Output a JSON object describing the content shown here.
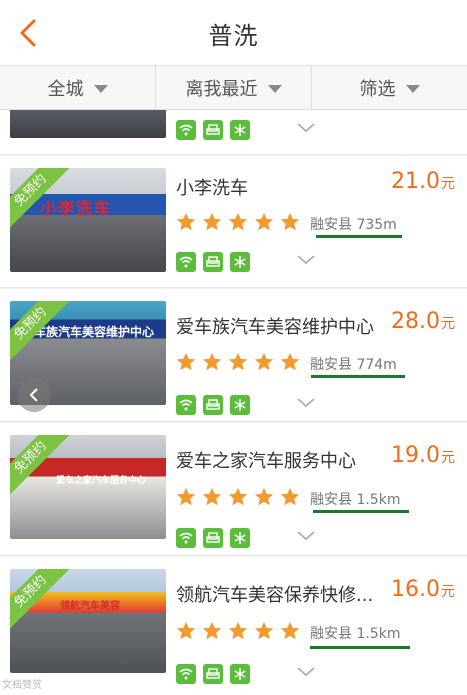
{
  "header": {
    "title": "普洗"
  },
  "filters": [
    {
      "label": "全城"
    },
    {
      "label": "离我最近"
    },
    {
      "label": "筛选"
    }
  ],
  "badge_label": "免预约",
  "currency_unit": "元",
  "accent_color": "#ee6b1c",
  "green_color": "#5cbd3d",
  "shops": [
    {
      "name": "小李洗车",
      "price": "21.0",
      "rating": 5,
      "district": "融安县",
      "distance": "735m",
      "sign": "小李洗车",
      "badge": true
    },
    {
      "name": "爱车族汽车美容维护中心",
      "price": "28.0",
      "rating": 5,
      "district": "融安县",
      "distance": "774m",
      "sign": "车族汽车美容维护中心",
      "badge": true
    },
    {
      "name": "爱车之家汽车服务中心",
      "price": "19.0",
      "rating": 5,
      "district": "融安县",
      "distance": "1.5km",
      "sign": "爱车之家汽车服务中心",
      "badge": true
    },
    {
      "name": "领航汽车美容保养快修...",
      "price": "16.0",
      "rating": 5,
      "district": "融安县",
      "distance": "1.5km",
      "sign": "领航汽车美容",
      "badge": true
    }
  ],
  "watermark": "文档赞赏"
}
